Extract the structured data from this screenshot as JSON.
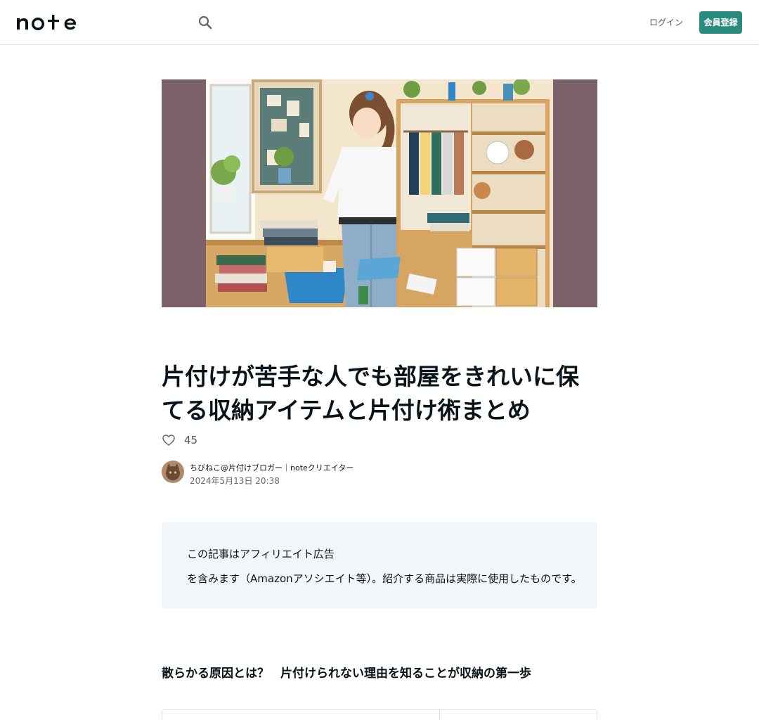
{
  "header": {
    "logo_text": "note",
    "login_label": "ログイン",
    "register_label": "会員登録",
    "colors": {
      "accent": "#2a8c7c"
    }
  },
  "hero": {
    "icon": "hero-illustration",
    "colors": {
      "frame": "#7c6268",
      "room": "#f6ead0"
    }
  },
  "article": {
    "title": "片付けが苦手な人でも部屋をきれいに保てる収納アイテムと片付け術まとめ",
    "likes": "45",
    "author_name": "ちびねこ@片付けブロガー｜noteクリエイター",
    "date": "2024年5月13日 20:38"
  },
  "notice": {
    "line1": "この記事はアフィリエイト広告",
    "line2": "を含みます（Amazonアソシエイト等）。紹介する商品は実際に使用したものです。"
  },
  "section": {
    "heading_part1": "散らかる原因とは？",
    "heading_part2": "片付けられない理由を知ることが収納の第一歩"
  }
}
